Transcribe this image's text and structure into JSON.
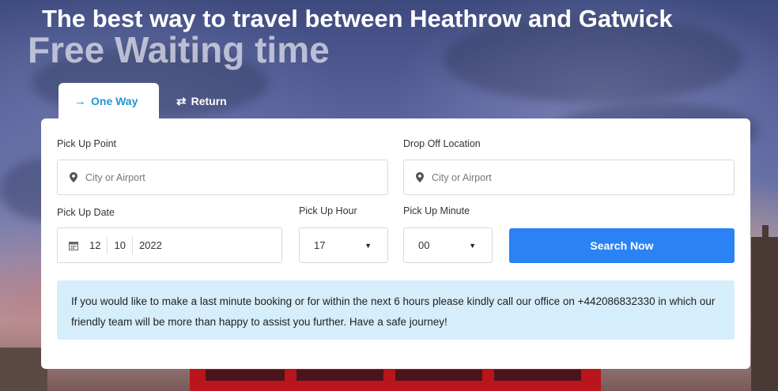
{
  "hero": {
    "title": "The best way to travel between Heathrow and Gatwick",
    "subtitle": "Free Waiting time"
  },
  "tabs": [
    {
      "icon": "arrow-right-icon",
      "label": "One Way",
      "active": true
    },
    {
      "icon": "swap-arrows-icon",
      "label": "Return",
      "active": false
    }
  ],
  "form": {
    "pickup_point": {
      "label": "Pick Up Point",
      "placeholder": "City or Airport",
      "value": ""
    },
    "dropoff_location": {
      "label": "Drop Off Location",
      "placeholder": "City or Airport",
      "value": ""
    },
    "pickup_date": {
      "label": "Pick Up Date",
      "day": "12",
      "month": "10",
      "year": "2022"
    },
    "pickup_hour": {
      "label": "Pick Up Hour",
      "value": "17"
    },
    "pickup_minute": {
      "label": "Pick Up Minute",
      "value": "00"
    },
    "search_label": "Search Now"
  },
  "notice": {
    "text": "If you would like to make a last minute booking or for within the next 6 hours please kindly call our office on +442086832330 in which our friendly team will be more than happy to assist you further. Have a safe journey!"
  },
  "colors": {
    "accent": "#2196d3",
    "button": "#2a82f4",
    "notice_bg": "#d6edfb"
  }
}
